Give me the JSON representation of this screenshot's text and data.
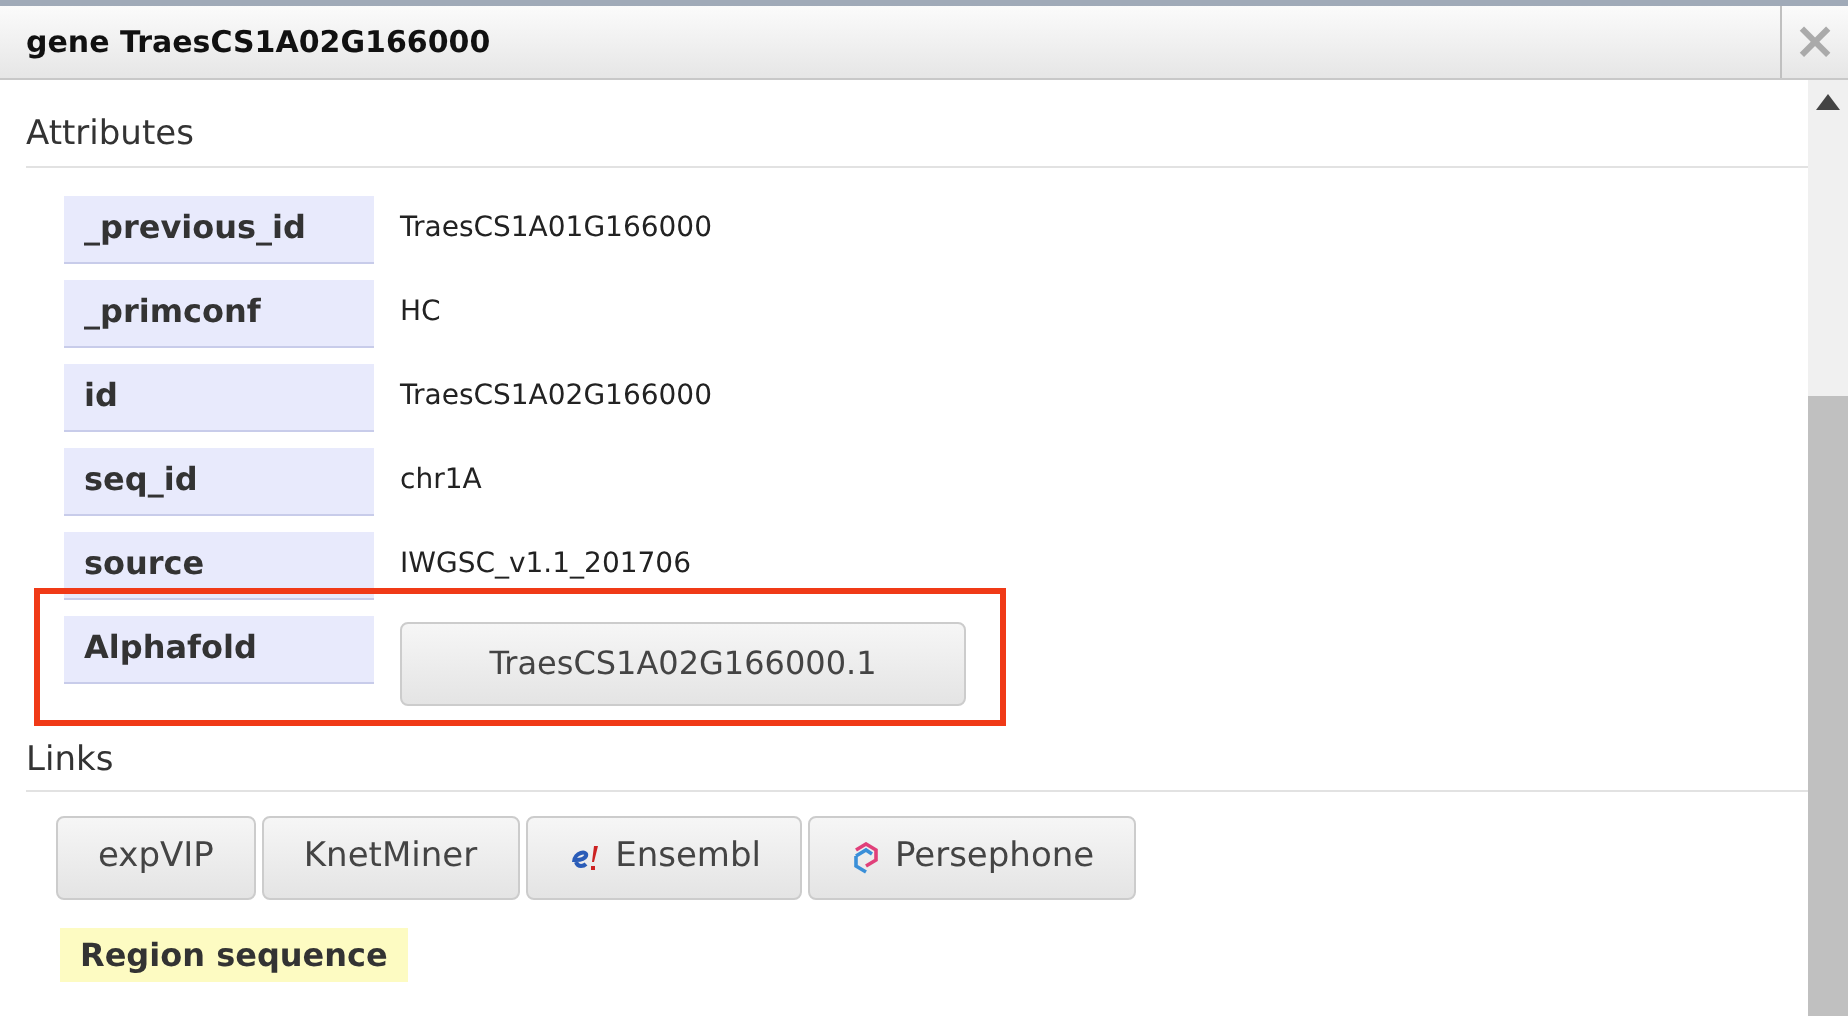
{
  "dialog": {
    "title": "gene TraesCS1A02G166000",
    "close": "×"
  },
  "attributes": {
    "heading": "Attributes",
    "rows": [
      {
        "key": "_previous_id",
        "value": "TraesCS1A01G166000",
        "kind": "text",
        "highlighted": false
      },
      {
        "key": "_primconf",
        "value": "HC",
        "kind": "text",
        "highlighted": false
      },
      {
        "key": "id",
        "value": "TraesCS1A02G166000",
        "kind": "text",
        "highlighted": false
      },
      {
        "key": "seq_id",
        "value": "chr1A",
        "kind": "text",
        "highlighted": false
      },
      {
        "key": "source",
        "value": "IWGSC_v1.1_201706",
        "kind": "text",
        "highlighted": false
      },
      {
        "key": "Alphafold",
        "value": "TraesCS1A02G166000.1",
        "kind": "button",
        "highlighted": true
      }
    ]
  },
  "links": {
    "heading": "Links",
    "buttons": [
      {
        "label": "expVIP",
        "kind": "plain"
      },
      {
        "label": "KnetMiner",
        "kind": "plain"
      },
      {
        "label": "Ensembl",
        "kind": "ensembl"
      },
      {
        "label": "Persephone",
        "kind": "persephone"
      }
    ],
    "region_sequence": "Region sequence"
  }
}
